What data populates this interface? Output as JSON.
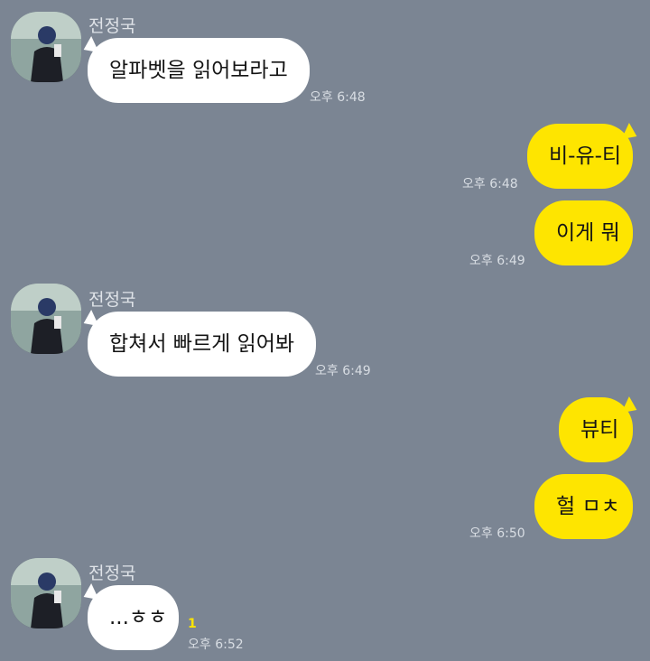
{
  "colors": {
    "background": "#7b8593",
    "incoming_bubble": "#ffffff",
    "outgoing_bubble": "#fee500",
    "unread": "#fee500"
  },
  "messages": [
    {
      "direction": "in",
      "sender": "전정국",
      "text": "알파벳을 읽어보라고",
      "time": "오후 6:48",
      "avatar": "profile-photo"
    },
    {
      "direction": "out",
      "text": "비-유-티",
      "time": "오후 6:48"
    },
    {
      "direction": "out",
      "text": "이게 뭐",
      "time": "오후 6:49"
    },
    {
      "direction": "in",
      "sender": "전정국",
      "text": "합쳐서 빠르게 읽어봐",
      "time": "오후 6:49",
      "avatar": "profile-photo"
    },
    {
      "direction": "out",
      "text": "뷰티"
    },
    {
      "direction": "out",
      "text": "헐 ㅁㅊ",
      "time": "오후 6:50"
    },
    {
      "direction": "in",
      "sender": "전정국",
      "text": "...ㅎㅎ",
      "time": "오후 6:52",
      "unread": "1",
      "avatar": "profile-photo"
    }
  ]
}
